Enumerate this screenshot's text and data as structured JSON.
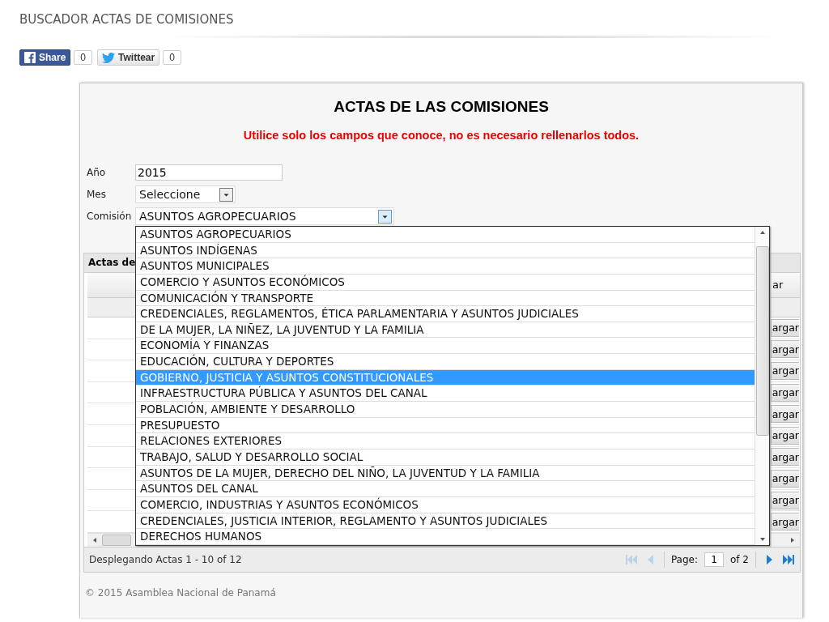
{
  "page": {
    "title": "BUSCADOR ACTAS DE COMISIONES"
  },
  "social": [
    {
      "kind": "facebook",
      "label": "Share",
      "count": "0"
    },
    {
      "kind": "twitter",
      "label": "Twittear",
      "count": "0"
    }
  ],
  "panel": {
    "title": "ACTAS DE LAS COMISIONES",
    "notice": "Utilice solo los campos que conoce, no es necesario rellenarlos todos."
  },
  "form": {
    "fields": [
      {
        "label": "Año",
        "kind": "text",
        "value": "2015"
      },
      {
        "label": "Mes",
        "kind": "select",
        "value": "Seleccione",
        "expanded": false
      },
      {
        "label": "Comisión",
        "kind": "select",
        "value": "ASUNTOS AGROPECUARIOS",
        "expanded": true
      }
    ]
  },
  "dropdown": {
    "options": [
      {
        "label": "ASUNTOS AGROPECUARIOS",
        "selected": false
      },
      {
        "label": "ASUNTOS INDÍGENAS",
        "selected": false
      },
      {
        "label": "ASUNTOS MUNICIPALES",
        "selected": false
      },
      {
        "label": "COMERCIO Y ASUNTOS ECONÓMICOS",
        "selected": false
      },
      {
        "label": "COMUNICACIÓN Y TRANSPORTE",
        "selected": false
      },
      {
        "label": "CREDENCIALES, REGLAMENTOS, ÉTICA PARLAMENTARIA Y ASUNTOS JUDICIALES",
        "selected": false
      },
      {
        "label": "DE LA MUJER, LA NIÑEZ, LA JUVENTUD Y LA FAMILIA",
        "selected": false
      },
      {
        "label": "ECONOMÍA Y FINANZAS",
        "selected": false
      },
      {
        "label": "EDUCACIÓN, CULTURA Y DEPORTES",
        "selected": false
      },
      {
        "label": "GOBIERNO, JUSTICIA Y ASUNTOS CONSTITUCIONALES",
        "selected": true
      },
      {
        "label": "INFRAESTRUCTURA PÚBLICA Y ASUNTOS DEL CANAL",
        "selected": false
      },
      {
        "label": "POBLACIÓN, AMBIENTE Y DESARROLLO",
        "selected": false
      },
      {
        "label": "PRESUPUESTO",
        "selected": false
      },
      {
        "label": "RELACIONES EXTERIORES",
        "selected": false
      },
      {
        "label": "TRABAJO, SALUD Y DESARROLLO SOCIAL",
        "selected": false
      },
      {
        "label": "ASUNTOS DE LA MUJER, DERECHO DEL NIÑO, LA JUVENTUD Y LA FAMILIA",
        "selected": false
      },
      {
        "label": "ASUNTOS DEL CANAL",
        "selected": false
      },
      {
        "label": "COMERCIO, INDUSTRIAS Y ASUNTOS ECONÓMICOS",
        "selected": false
      },
      {
        "label": "CREDENCIALES, JUSTICIA INTERIOR, REGLAMENTO Y ASUNTOS JUDICIALES",
        "selected": false
      },
      {
        "label": "DERECHOS HUMANOS",
        "selected": false
      }
    ]
  },
  "grid": {
    "caption": "Actas de",
    "column": "ar",
    "rows": [
      {
        "action": "argar"
      },
      {
        "action": "argar"
      },
      {
        "action": "argar"
      },
      {
        "action": "argar"
      },
      {
        "action": "argar"
      },
      {
        "action": "argar"
      },
      {
        "action": "argar"
      },
      {
        "action": "argar"
      },
      {
        "action": "argar"
      },
      {
        "action": "argar"
      }
    ]
  },
  "pager": {
    "summary": "Desplegando Actas 1 - 10 of 12",
    "page_label": "Page:",
    "page": "1",
    "total": "of 2",
    "buttons": [
      {
        "kind": "first",
        "disabled": true
      },
      {
        "kind": "prev",
        "disabled": true
      },
      {
        "kind": "next",
        "disabled": false
      },
      {
        "kind": "last",
        "disabled": false
      }
    ]
  },
  "footer": "© 2015 Asamblea Nacional de Panamá"
}
